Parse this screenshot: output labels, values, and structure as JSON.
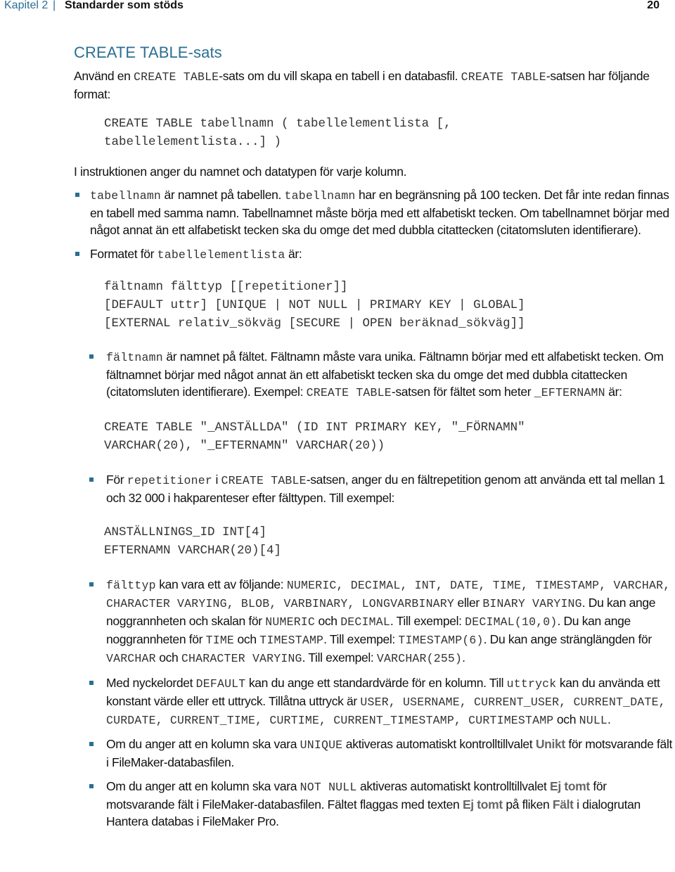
{
  "header": {
    "chapter": "Kapitel 2",
    "separator": "|",
    "title": "Standarder som stöds",
    "page_number": "20"
  },
  "section": {
    "heading": "CREATE TABLE-sats",
    "intro": {
      "t1": "Använd en ",
      "c1": "CREATE TABLE",
      "t2": "-sats om du vill skapa en tabell i en databasfil. ",
      "c2": "CREATE TABLE",
      "t3": "-satsen har följande format:"
    },
    "syntax_lines": [
      "CREATE TABLE tabellnamn ( tabellelementlista [,",
      "tabellelementlista...] )"
    ],
    "p2": "I instruktionen anger du namnet och datatypen för varje kolumn.",
    "bullet_tabellnamn": {
      "c1": "tabellnamn",
      "t1": " är namnet på tabellen. ",
      "c2": "tabellnamn",
      "t2": " har en begränsning på 100 tecken. Det får inte redan finnas en tabell med samma namn. Tabellnamnet måste börja med ett alfabetiskt tecken. Om tabellnamnet börjar med något annat än ett alfabetiskt tecken ska du omge det med dubbla citattecken (citatomsluten identifierare)."
    },
    "bullet_format": {
      "t1": "Formatet för ",
      "c1": "tabellelementlista",
      "t2": " är:"
    },
    "element_syntax_lines": [
      "fältnamn fälttyp [[repetitioner]]",
      "[DEFAULT uttr] [UNIQUE | NOT NULL | PRIMARY KEY | GLOBAL]",
      "[EXTERNAL relativ_sökväg [SECURE | OPEN beräknad_sökväg]]"
    ],
    "bullet_faltnamn": {
      "c1": "fältnamn",
      "t1": " är namnet på fältet. Fältnamn måste vara unika. Fältnamn börjar med ett alfabetiskt tecken. Om fältnamnet börjar med något annat än ett alfabetiskt tecken ska du omge det med dubbla citattecken (citatomsluten identifierare). Exempel: ",
      "c2": "CREATE TABLE",
      "t2": "-satsen för fältet som heter ",
      "c3": "_EFTERNAMN",
      "t3": " är:"
    },
    "example1_lines": [
      "CREATE TABLE \"_ANSTÄLLDA\" (ID INT PRIMARY KEY, \"_FÖRNAMN\"",
      "VARCHAR(20), \"_EFTERNAMN\" VARCHAR(20))"
    ],
    "bullet_repetitioner": {
      "t1": "För ",
      "c1": "repetitioner",
      "t2": " i ",
      "c2": "CREATE TABLE",
      "t3": "-satsen, anger du en fältrepetition genom att använda ett tal mellan 1 och 32 000 i hakparenteser efter fälttypen. Till exempel:"
    },
    "example2_lines": [
      "ANSTÄLLNINGS_ID INT[4]",
      "EFTERNAMN VARCHAR(20)[4]"
    ],
    "bullet_falttyp": {
      "c1": "fälttyp",
      "t1": " kan vara ett av följande: ",
      "c2": "NUMERIC, DECIMAL, INT, DATE, TIME, TIMESTAMP, VARCHAR, CHARACTER VARYING, BLOB, VARBINARY, LONGVARBINARY",
      "t2": " eller ",
      "c3": "BINARY VARYING",
      "t3": ". Du kan ange noggrannheten och skalan för ",
      "c4": "NUMERIC",
      "t4": " och ",
      "c5": "DECIMAL",
      "t5": ". Till exempel: ",
      "c6": "DECIMAL(10,0)",
      "t6": ". Du kan ange noggrannheten för ",
      "c7": "TIME",
      "t7": " och ",
      "c8": "TIMESTAMP",
      "t8": ". Till exempel: ",
      "c9": "TIMESTAMP(6)",
      "t9": ". Du kan ange stränglängden för ",
      "c10": "VARCHAR",
      "t10": " och ",
      "c11": "CHARACTER VARYING",
      "t11": ". Till exempel: ",
      "c12": "VARCHAR(255)",
      "t12": "."
    },
    "bullet_default": {
      "t1": "Med nyckelordet ",
      "c1": "DEFAULT",
      "t2": " kan du ange ett standardvärde för en kolumn. Till ",
      "c2": "uttryck",
      "t3": " kan du använda ett konstant värde eller ett uttryck. Tillåtna uttryck är ",
      "c3": "USER, USERNAME, CURRENT_USER, CURRENT_DATE, CURDATE, CURRENT_TIME, CURTIME, CURRENT_TIMESTAMP, CURTIMESTAMP",
      "t4": " och ",
      "c4": "NULL",
      "t5": "."
    },
    "bullet_unique": {
      "t1": "Om du anger att en kolumn ska vara ",
      "c1": "UNIQUE",
      "t2": " aktiveras automatiskt kontrolltillvalet ",
      "u1": "Unikt",
      "t3": " för motsvarande fält i FileMaker-databasfilen."
    },
    "bullet_notnull": {
      "t1": "Om du anger att en kolumn ska vara ",
      "c1": "NOT NULL",
      "t2": " aktiveras automatiskt kontrolltillvalet ",
      "u1": "Ej tomt",
      "t3": " för motsvarande fält i FileMaker-databasfilen. Fältet flaggas med texten ",
      "u2": "Ej tomt",
      "t4": " på fliken ",
      "u3": "Fält",
      "t5": " i dialogrutan Hantera databas i FileMaker Pro."
    }
  }
}
